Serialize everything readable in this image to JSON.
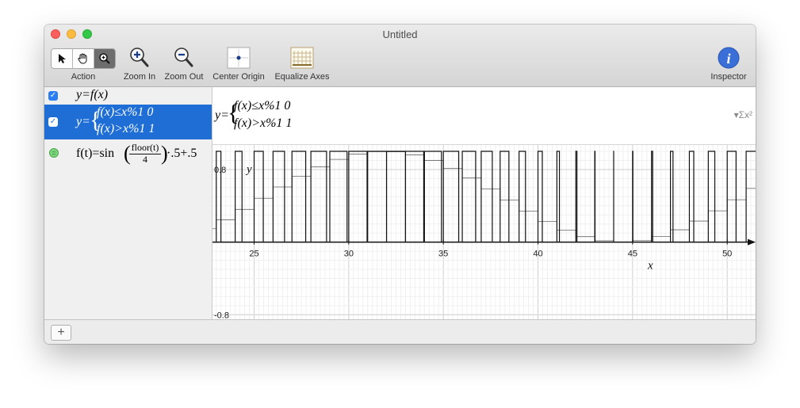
{
  "window": {
    "title": "Untitled"
  },
  "toolbar": {
    "action_label": "Action",
    "zoom_in_label": "Zoom In",
    "zoom_out_label": "Zoom Out",
    "center_origin_label": "Center Origin",
    "equalize_axes_label": "Equalize Axes",
    "inspector_label": "Inspector"
  },
  "sidebar": {
    "items": [
      {
        "expr": "y=f(x)",
        "checked": true
      },
      {
        "prefix": "y=",
        "case1": "f(x)≤x%1 0",
        "case2": "f(x)>x%1 1",
        "checked": true,
        "selected": true
      },
      {
        "lhs": "f(t)=sin",
        "frac_num": "floor(t)",
        "frac_den": "4",
        "tail": "·.5+.5"
      }
    ]
  },
  "editor": {
    "prefix": "y=",
    "case1": "f(x)≤x%1 0",
    "case2": "f(x)>x%1 1",
    "menu_label": "▾Σx²"
  },
  "chart_data": {
    "type": "line",
    "xlabel": "x",
    "ylabel": "y",
    "x_range": [
      22.8,
      51.5
    ],
    "y_range": [
      -0.85,
      1.07
    ],
    "x_ticks": [
      "25",
      "30",
      "35",
      "40",
      "45",
      "50"
    ],
    "y_ticks": [
      "0.8",
      "-0.8"
    ],
    "series": [
      {
        "kind": "square-wave",
        "description_values": "y alternates between 0 and 1 on intervals of half unit"
      },
      {
        "kind": "step",
        "formula_ref": "sidebar.items.2"
      }
    ]
  },
  "colors": {
    "selection": "#1e6ed6",
    "accent": "#2b7df2"
  }
}
